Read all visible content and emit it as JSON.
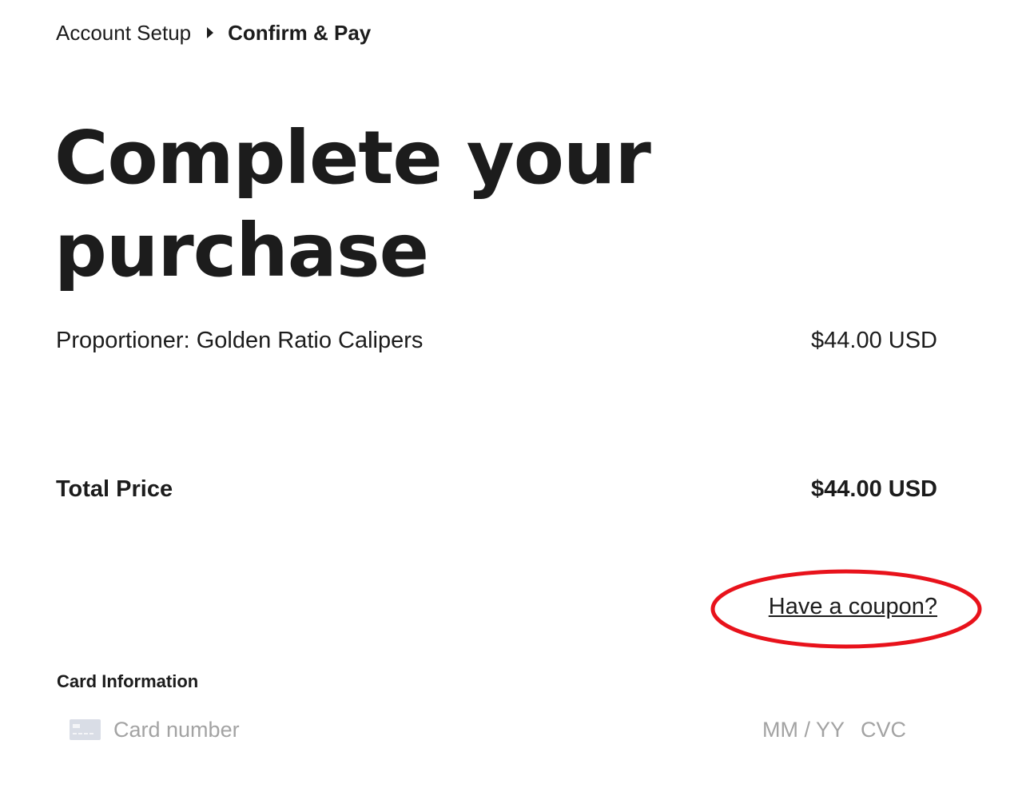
{
  "breadcrumb": {
    "items": [
      {
        "label": "Account Setup"
      },
      {
        "label": "Confirm & Pay"
      }
    ],
    "separator_icon": "caret-right-icon"
  },
  "page": {
    "title": "Complete your purchase"
  },
  "order": {
    "item_name": "Proportioner: Golden Ratio Calipers",
    "item_price": "$44.00 USD",
    "total_label": "Total Price",
    "total_value": "$44.00 USD"
  },
  "coupon": {
    "link_label": "Have a coupon?",
    "highlight_color": "#e8121b"
  },
  "card": {
    "section_label": "Card Information",
    "number_placeholder": "Card number",
    "expiry_placeholder": "MM / YY",
    "cvc_placeholder": "CVC",
    "card_icon": "credit-card-icon"
  }
}
